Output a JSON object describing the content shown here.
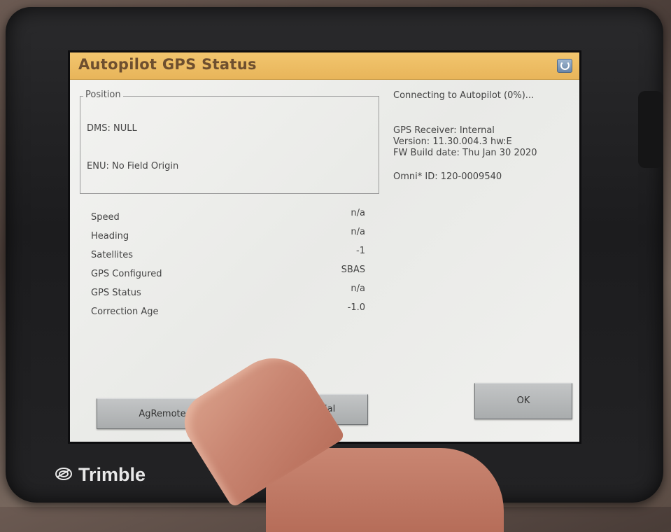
{
  "window": {
    "title": "Autopilot GPS Status"
  },
  "position": {
    "legend": "Position",
    "dms": "DMS: NULL",
    "enu": "ENU: No Field Origin"
  },
  "status": {
    "rows": [
      {
        "label": "Speed",
        "value": "n/a"
      },
      {
        "label": "Heading",
        "value": "n/a"
      },
      {
        "label": "Satellites",
        "value": "-1"
      },
      {
        "label": "GPS Configured",
        "value": "SBAS"
      },
      {
        "label": "GPS Status",
        "value": "n/a"
      },
      {
        "label": "Correction Age",
        "value": "-1.0"
      }
    ]
  },
  "connection": {
    "status": "Connecting to Autopilot (0%)...",
    "receiver": "GPS Receiver: Internal",
    "version": "Version: 11.30.004.3 hw:E",
    "build_date": "FW Build date: Thu Jan 30 2020",
    "omni_id": "Omni* ID: 120-0009540"
  },
  "buttons": {
    "agremote": "AgRemote",
    "log_gps_serial": "Log GPS Serial",
    "ok": "OK"
  },
  "device": {
    "brand": "Trimble"
  },
  "colors": {
    "title_bar": "#e8b55a",
    "title_text": "#6e4f2f",
    "screen_bg": "#efefed",
    "button_bg": "#b5b8b9"
  },
  "icons": {
    "help": "help-icon",
    "brand_logo": "trimble-logo-icon"
  }
}
